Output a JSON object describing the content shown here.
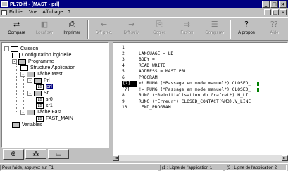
{
  "window": {
    "title": "PL7Diff - [MAST - prl]",
    "min": "_",
    "max": "□",
    "close": "×"
  },
  "menu": {
    "items": [
      "Fichier",
      "Vue",
      "Affichage",
      "?"
    ]
  },
  "toolbar": {
    "buttons": [
      {
        "label": "Compare",
        "icon": "compare-icon",
        "glyph": "⇄",
        "enabled": true
      },
      {
        "label": "Localiser",
        "icon": "locate-icon",
        "glyph": "◧",
        "enabled": false
      },
      {
        "label": "Imprimer",
        "icon": "print-icon",
        "glyph": "⎙",
        "enabled": true
      },
      {
        "label": "Diff préc.",
        "icon": "prev-diff-icon",
        "glyph": "←",
        "enabled": false
      },
      {
        "label": "Diff suiv.",
        "icon": "next-diff-icon",
        "glyph": "→",
        "enabled": false
      },
      {
        "label": "Copier",
        "icon": "copy-icon",
        "glyph": "⎘",
        "enabled": false
      },
      {
        "label": "Fusion",
        "icon": "merge-icon",
        "glyph": "⇉",
        "enabled": false
      },
      {
        "label": "Comparer",
        "icon": "compare-list-icon",
        "glyph": "☰",
        "enabled": false
      },
      {
        "label": "A propos",
        "icon": "about-icon",
        "glyph": "?",
        "enabled": true
      },
      {
        "label": "Aide",
        "icon": "help-icon",
        "glyph": "⁇",
        "enabled": false
      }
    ]
  },
  "tree": {
    "nodes": [
      {
        "label": "Cuisson",
        "icon": "station",
        "exp": "-"
      },
      {
        "label": "Configuration logicielle",
        "icon": "config"
      },
      {
        "label": "Programme",
        "icon": "folder",
        "exp": "-"
      },
      {
        "label": "Structure Application",
        "icon": "struct"
      },
      {
        "label": "Tâche Mast",
        "icon": "folder",
        "exp": "-"
      },
      {
        "label": "Prl",
        "icon": "folder",
        "exp": "-"
      },
      {
        "label": "prl",
        "icon": "LD",
        "selected": true
      },
      {
        "label": "Sr",
        "icon": "folder",
        "exp": "-"
      },
      {
        "label": "sr0",
        "icon": "LD"
      },
      {
        "label": "sr1",
        "icon": "LD"
      },
      {
        "label": "Tâche Fast",
        "icon": "folder",
        "exp": "-"
      },
      {
        "label": "FAST_MAIN",
        "icon": "LD"
      },
      {
        "label": "Variables",
        "icon": "folder"
      }
    ],
    "tabs": [
      "⊕",
      "⁂",
      "▭"
    ]
  },
  "editor": {
    "lines": [
      {
        "num": "1",
        "text": ""
      },
      {
        "num": "2",
        "text": "LANGUAGE = LD"
      },
      {
        "num": "3",
        "text": "BODY ="
      },
      {
        "num": "4",
        "text": "READ_WRITE"
      },
      {
        "num": "5",
        "text": "ADDRESS = MAST PRL"
      },
      {
        "num": "6",
        "text": "PROGRAM"
      },
      {
        "num": "[7]",
        "text": "<! RUNG (*Passage en mode manuel*) CLOSED_",
        "hl": true,
        "bar": true
      },
      {
        "num": "[7]",
        "text": "!> RUNG (*Passage en mode manuel*) CLOSED_",
        "bar": true
      },
      {
        "num": "8",
        "text": "RUNG (*Reinitialisation du Grafcet*) H_LI"
      },
      {
        "num": "9",
        "text": "RUNG (*Erreur*) CLOSED_CONTACT(%M3),V_LINE"
      },
      {
        "num": "10",
        "text": " END_PROGRAM"
      }
    ]
  },
  "scroll": {
    "left": "◄",
    "right": "►"
  },
  "status": {
    "help": "Pour l'aide, appuyez sur F1",
    "cells": [
      "(1 : Ligne de l'application 1",
      "(3 : Ligne de l'application 2"
    ]
  },
  "colors": {
    "title_bg": "#000080",
    "selection": "#000080",
    "diff_bar": "#008000"
  }
}
